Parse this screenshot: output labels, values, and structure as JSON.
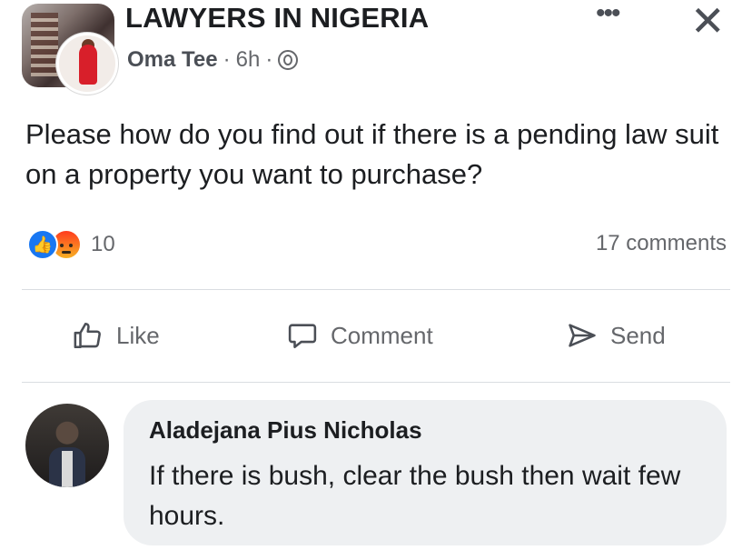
{
  "post": {
    "group_name": "LAWYERS IN NIGERIA",
    "author": "Oma Tee",
    "time": "6h",
    "separator": "·",
    "privacy_icon": "globe-icon",
    "text": "Please how do you find out if there is a pending law suit on a property you want to purchase?",
    "reaction_count": "10",
    "comment_count": "17 comments",
    "reaction_icons": [
      "like-reaction-icon",
      "angry-reaction-icon"
    ]
  },
  "header": {
    "more_icon": "more-icon",
    "close_icon": "close-icon"
  },
  "actions": {
    "like": "Like",
    "comment": "Comment",
    "send": "Send"
  },
  "comment": {
    "author": "Aladejana Pius Nicholas",
    "text": "If there is bush, clear the bush then wait few hours."
  },
  "colors": {
    "like_blue": "#1877f2",
    "meta_gray": "#65676b",
    "bubble": "#eef0f2"
  }
}
